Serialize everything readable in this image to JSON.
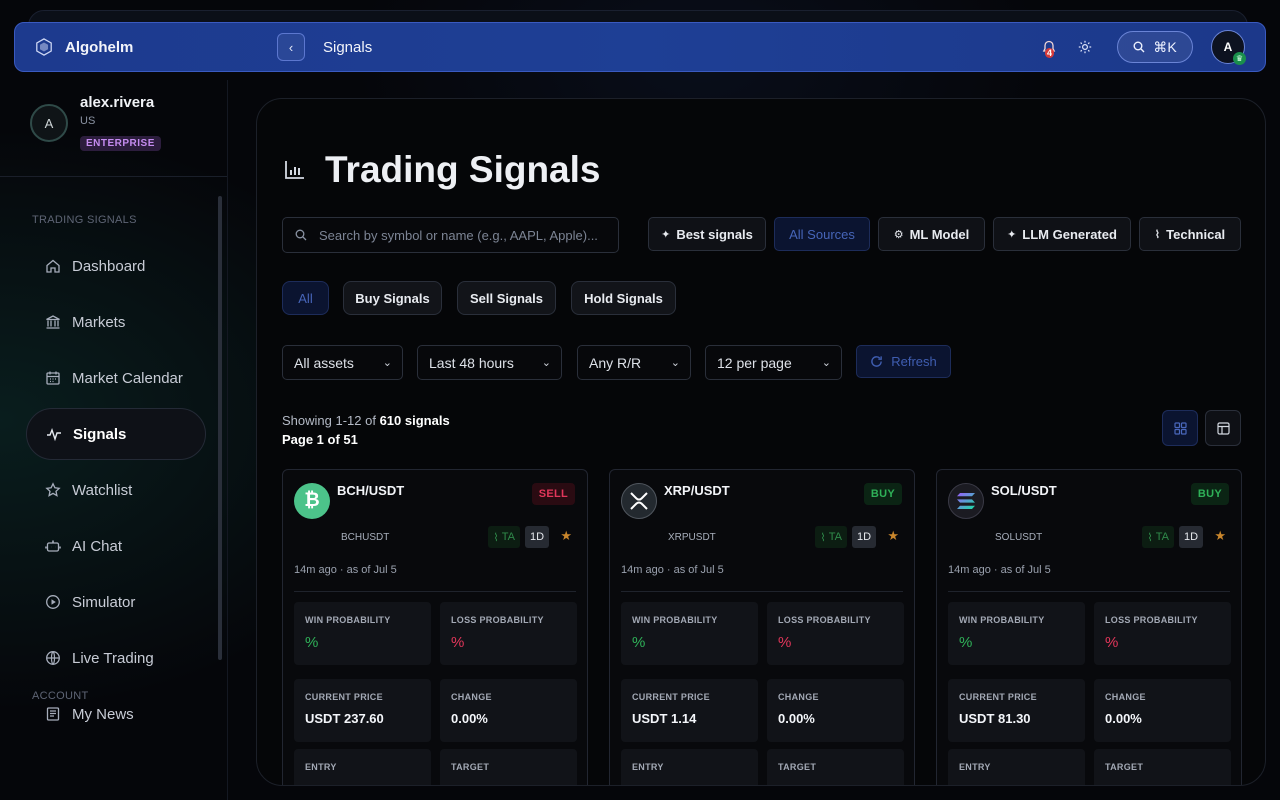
{
  "app": {
    "name": "Algohelm",
    "page_label": "Signals",
    "notification_count": "4",
    "search_shortcut": "⌘K",
    "avatar_initial": "A"
  },
  "profile": {
    "name": "alex.rivera",
    "country": "US",
    "plan": "ENTERPRISE",
    "initial": "A"
  },
  "sidebar": {
    "section": "TRADING SIGNALS",
    "items": [
      {
        "label": "Dashboard",
        "icon": "home-icon"
      },
      {
        "label": "Markets",
        "icon": "bank-icon"
      },
      {
        "label": "Market Calendar",
        "icon": "calendar-icon"
      },
      {
        "label": "Signals",
        "icon": "pulse-icon",
        "active": true
      },
      {
        "label": "Watchlist",
        "icon": "star-icon"
      },
      {
        "label": "AI Chat",
        "icon": "robot-icon"
      },
      {
        "label": "Simulator",
        "icon": "play-icon"
      },
      {
        "label": "Live Trading",
        "icon": "globe-icon"
      },
      {
        "label": "My News",
        "icon": "newspaper-icon"
      }
    ],
    "section2": "ACCOUNT"
  },
  "main": {
    "title": "Trading Signals",
    "search_placeholder": "Search by symbol or name (e.g., AAPL, Apple)...",
    "sources": [
      "Best signals",
      "All Sources",
      "ML Model",
      "LLM Generated",
      "Technical"
    ],
    "signal_filters": [
      "All",
      "Buy Signals",
      "Sell Signals",
      "Hold Signals"
    ],
    "selects": [
      "All assets",
      "Last 48 hours",
      "Any R/R",
      "12 per page"
    ],
    "refresh_label": "Refresh",
    "showing_prefix": "Showing 1-12 of ",
    "showing_count": "610 signals",
    "page_info": "Page 1 of 51"
  },
  "cards": [
    {
      "pair": "BCH/USDT",
      "signal": "SELL",
      "ticker": "BCHUSDT",
      "ta": "TA",
      "timeframe": "1D",
      "age": "14m ago",
      "as_of": "as of Jul 5",
      "win_label": "WIN PROBABILITY",
      "win_value": "%",
      "loss_label": "LOSS PROBABILITY",
      "loss_value": "%",
      "price_label": "CURRENT PRICE",
      "price_value": "USDT 237.60",
      "change_label": "CHANGE",
      "change_value": "0.00%",
      "entry_label": "ENTRY",
      "target_label": "TARGET",
      "icon": "bitcoin-cash-icon",
      "icon_color": "#4cc38a"
    },
    {
      "pair": "XRP/USDT",
      "signal": "BUY",
      "ticker": "XRPUSDT",
      "ta": "TA",
      "timeframe": "1D",
      "age": "14m ago",
      "as_of": "as of Jul 5",
      "win_label": "WIN PROBABILITY",
      "win_value": "%",
      "loss_label": "LOSS PROBABILITY",
      "loss_value": "%",
      "price_label": "CURRENT PRICE",
      "price_value": "USDT 1.14",
      "change_label": "CHANGE",
      "change_value": "0.00%",
      "entry_label": "ENTRY",
      "target_label": "TARGET",
      "icon": "xrp-icon",
      "icon_color": "#23292f"
    },
    {
      "pair": "SOL/USDT",
      "signal": "BUY",
      "ticker": "SOLUSDT",
      "ta": "TA",
      "timeframe": "1D",
      "age": "14m ago",
      "as_of": "as of Jul 5",
      "win_label": "WIN PROBABILITY",
      "win_value": "%",
      "loss_label": "LOSS PROBABILITY",
      "loss_value": "%",
      "price_label": "CURRENT PRICE",
      "price_value": "USDT 81.30",
      "change_label": "CHANGE",
      "change_value": "0.00%",
      "entry_label": "ENTRY",
      "target_label": "TARGET",
      "icon": "solana-icon",
      "icon_color": "#1b1b22"
    }
  ],
  "colors": {
    "accent": "#1e3f95",
    "buy": "#2fb158",
    "sell": "#e2365a",
    "star": "#c9862c"
  }
}
